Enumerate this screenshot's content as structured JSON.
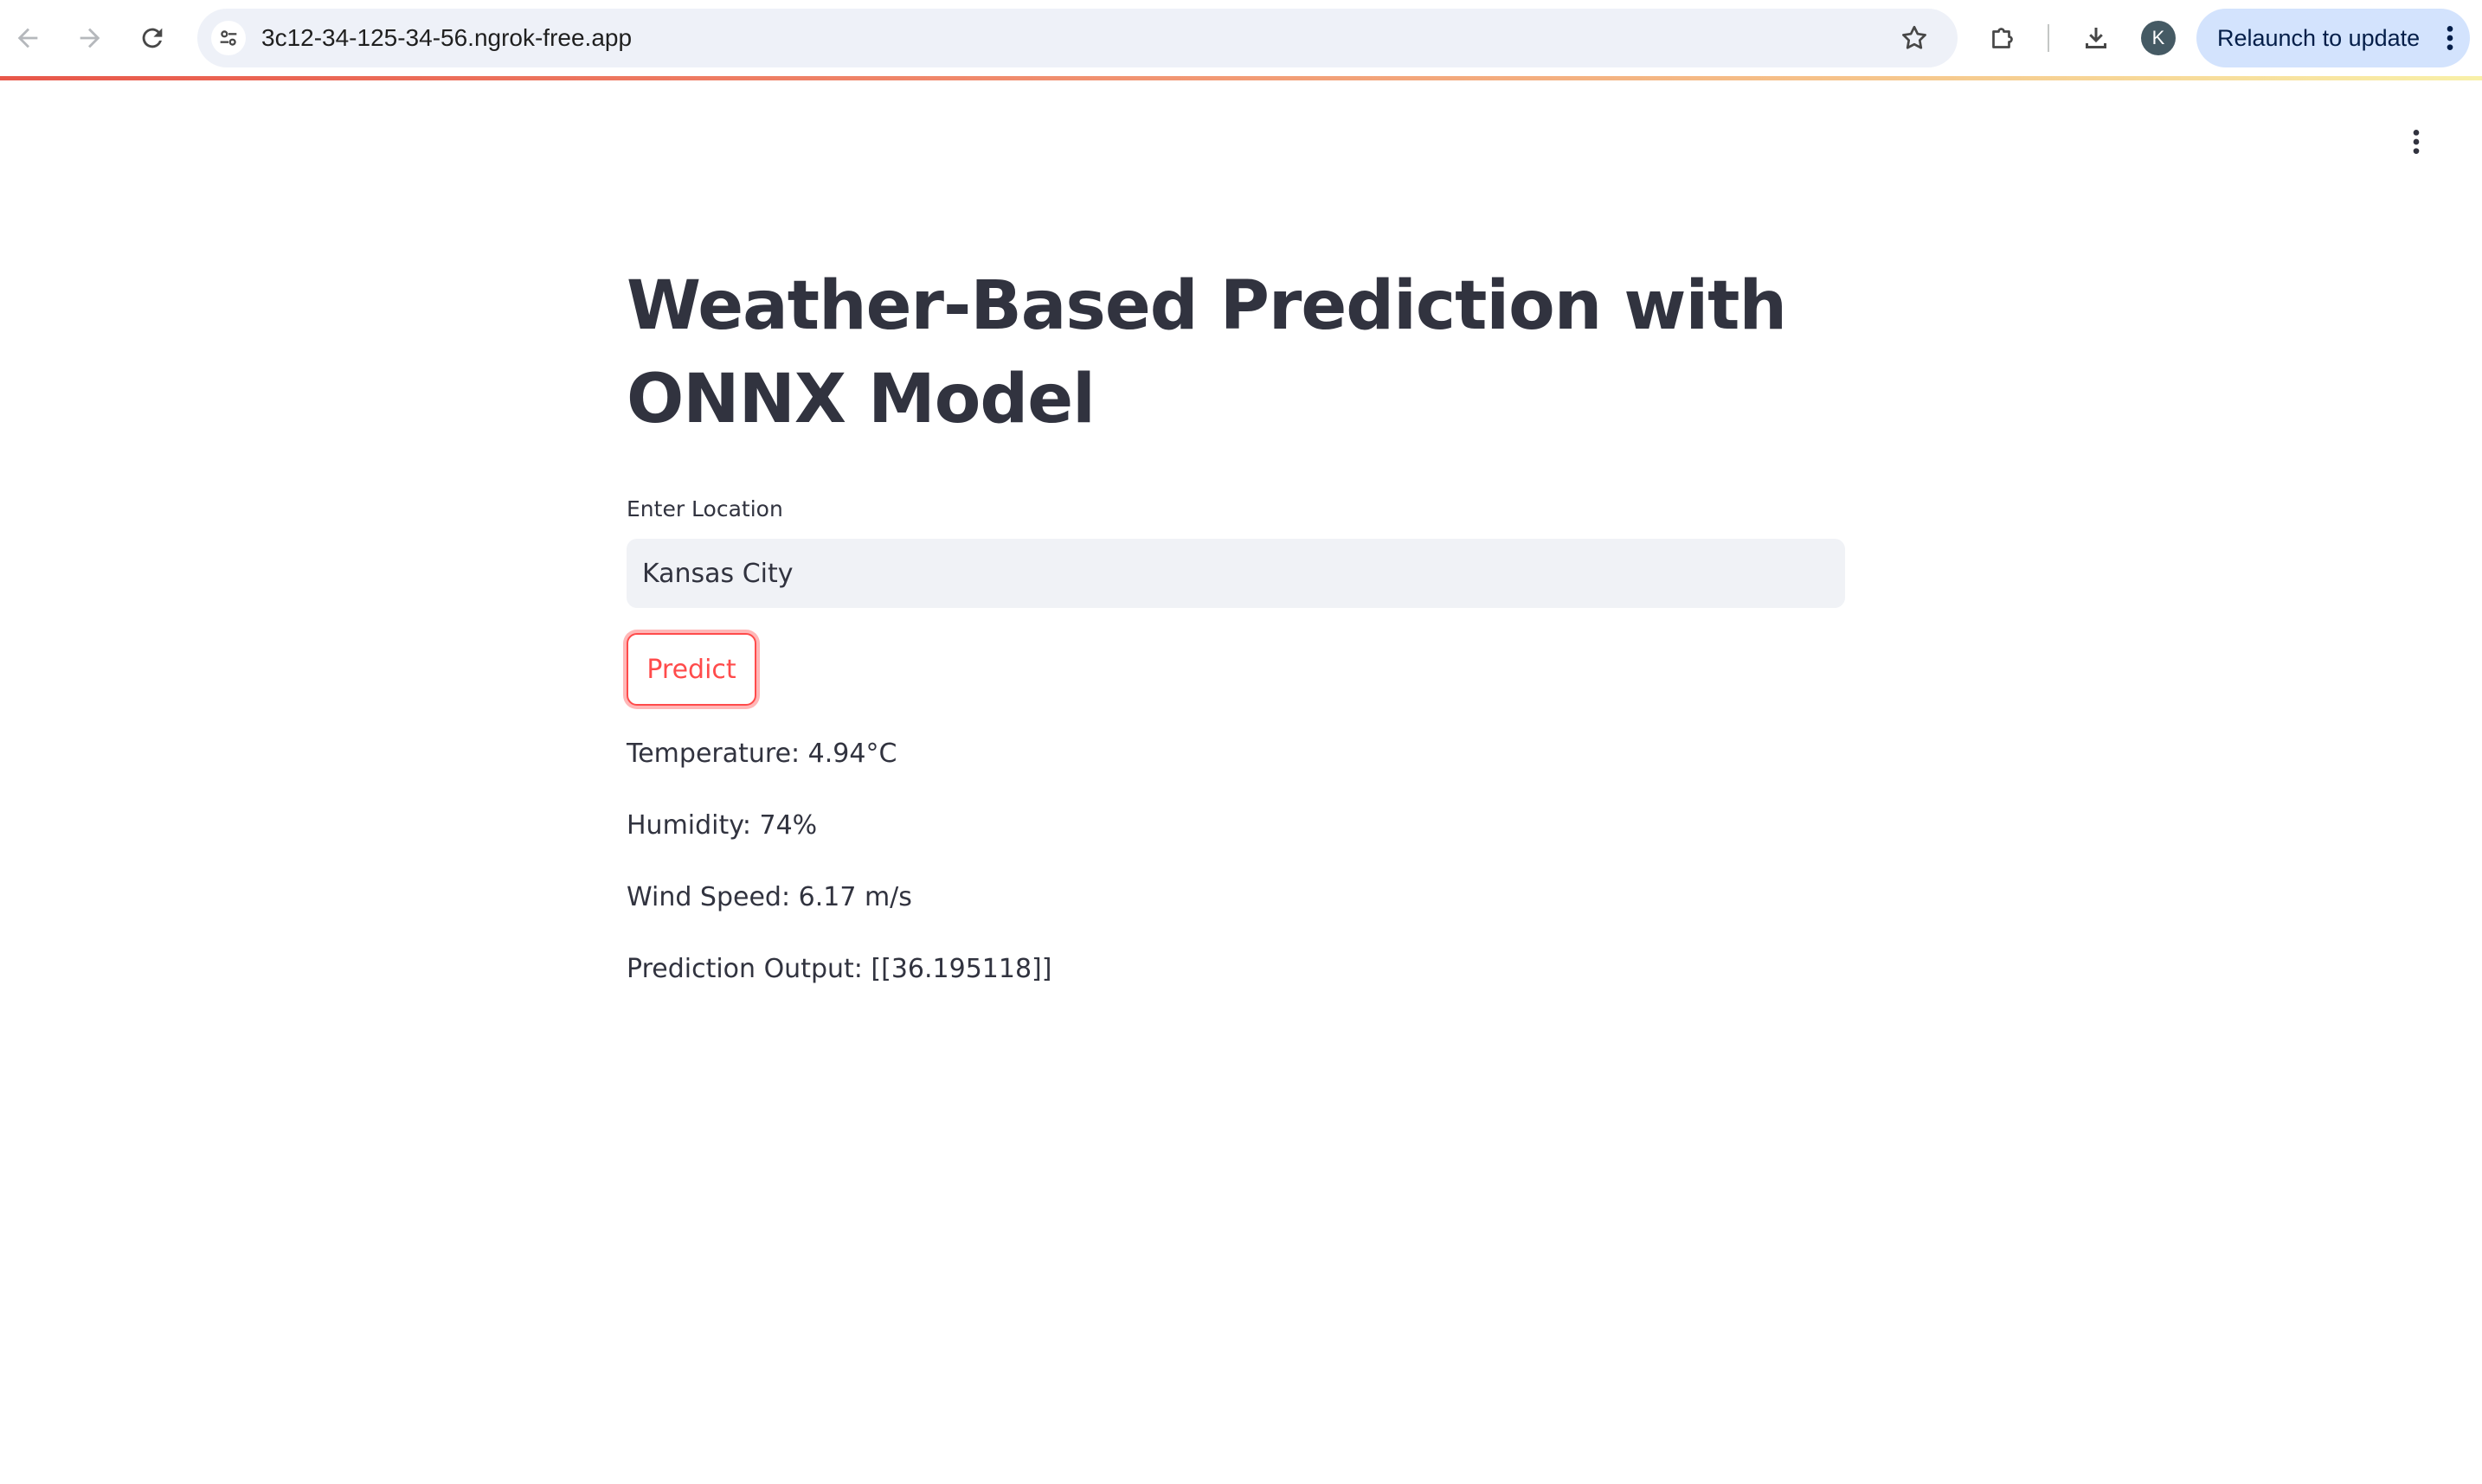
{
  "browser": {
    "url": "3c12-34-125-34-56.ngrok-free.app",
    "avatar_letter": "K",
    "relaunch_label": "Relaunch to update",
    "accent_color": "#d3e3fd"
  },
  "icons": {
    "back": "back-arrow-icon",
    "forward": "forward-arrow-icon",
    "reload": "reload-icon",
    "site_info": "tune-icon",
    "bookmark": "star-icon",
    "extensions": "puzzle-icon",
    "download": "download-icon",
    "menu": "kebab-icon"
  },
  "app": {
    "title": "Weather-Based Prediction with ONNX Model",
    "location_label": "Enter Location",
    "location_value": "Kansas City",
    "predict_label": "Predict",
    "primary_color": "#ff4b4b",
    "results": {
      "temperature": "Temperature: 4.94°C",
      "humidity": "Humidity: 74%",
      "wind_speed": "Wind Speed: 6.17 m/s",
      "prediction": "Prediction Output: [[36.195118]]"
    }
  }
}
